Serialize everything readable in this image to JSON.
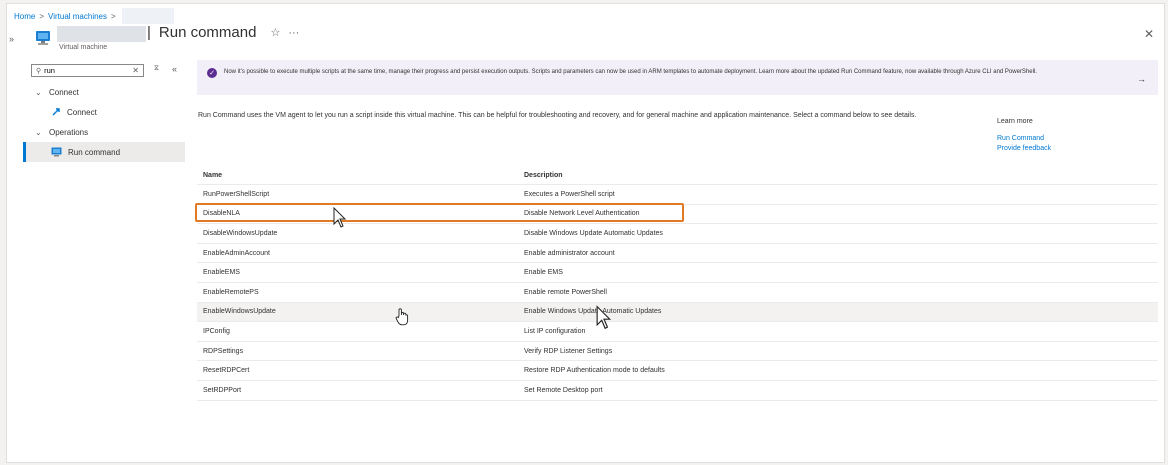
{
  "breadcrumb": {
    "home": "Home",
    "virtual_machines": "Virtual machines"
  },
  "resource": {
    "subtitle": "Virtual machine"
  },
  "page": {
    "title": "Run command",
    "separator": "|"
  },
  "search": {
    "value": "run"
  },
  "nav": {
    "connect_group": "Connect",
    "connect_item": "Connect",
    "operations_group": "Operations",
    "run_command_item": "Run command"
  },
  "banner": {
    "text": "Now it's possible to execute multiple scripts at the same time, manage their progress and persist execution outputs. Scripts and parameters can now be used in ARM templates to automate deployment. Learn more about the updated Run Command feature, now available through Azure CLI and PowerShell."
  },
  "description": "Run Command uses the VM agent to let you run a script inside this virtual machine. This can be helpful for troubleshooting and recovery, and for general machine and application maintenance. Select a command below to see details.",
  "learn_more": {
    "heading": "Learn more",
    "links": [
      "Run Command",
      "Provide feedback"
    ]
  },
  "table": {
    "headers": [
      "Name",
      "Description"
    ],
    "rows": [
      {
        "name": "RunPowerShellScript",
        "description": "Executes a PowerShell script"
      },
      {
        "name": "DisableNLA",
        "description": "Disable Network Level Authentication"
      },
      {
        "name": "DisableWindowsUpdate",
        "description": "Disable Windows Update Automatic Updates"
      },
      {
        "name": "EnableAdminAccount",
        "description": "Enable administrator account"
      },
      {
        "name": "EnableEMS",
        "description": "Enable EMS"
      },
      {
        "name": "EnableRemotePS",
        "description": "Enable remote PowerShell"
      },
      {
        "name": "EnableWindowsUpdate",
        "description": "Enable Windows Update Automatic Updates"
      },
      {
        "name": "IPConfig",
        "description": "List IP configuration"
      },
      {
        "name": "RDPSettings",
        "description": "Verify RDP Listener Settings"
      },
      {
        "name": "ResetRDPCert",
        "description": "Restore RDP Authentication mode to defaults"
      },
      {
        "name": "SetRDPPort",
        "description": "Set Remote Desktop port"
      }
    ]
  },
  "colors": {
    "accent": "#0078d4",
    "highlight": "#e07a25",
    "banner_bg": "#f3eff8"
  },
  "icons": [
    "chevron-right-icon",
    "virtual-machine-icon",
    "star-icon",
    "more-icon",
    "close-icon",
    "search-icon",
    "clear-icon",
    "filter-icon",
    "collapse-icon",
    "chevron-down-icon",
    "connect-icon",
    "run-command-icon",
    "info-icon",
    "arrow-right-icon",
    "mouse-pointer-icon",
    "hand-pointer-icon"
  ]
}
